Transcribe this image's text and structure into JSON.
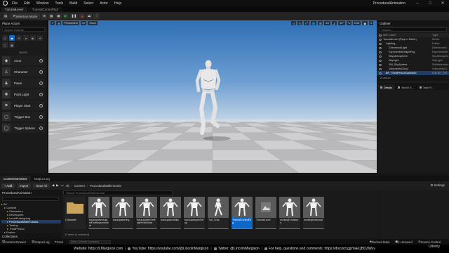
{
  "menu": {
    "items": [
      "File",
      "Edit",
      "Window",
      "Tools",
      "Build",
      "Select",
      "Actor",
      "Help"
    ],
    "project": "ProceduralAnimation"
  },
  "tabs": [
    "TutorialLevel",
    "TutorialControlRig*"
  ],
  "toolbar": {
    "mode": "Selection Mode"
  },
  "place_actors": {
    "title": "Place Actors",
    "search_placeholder": "Search Classes",
    "category_label": "BASIC",
    "actors": [
      "Actor",
      "Character",
      "Pawn",
      "Point Light",
      "Player Start",
      "Trigger Box",
      "Trigger Sphere"
    ]
  },
  "viewport": {
    "buttons_left": [
      "≡",
      "⊕",
      "Perspective",
      "Lit",
      "Show"
    ],
    "buttons_right": [
      "◇",
      "↻",
      "⤢",
      "🌐",
      "⊞",
      "10",
      "∠",
      "10°",
      "⤡",
      "0.25",
      "▣",
      "4"
    ]
  },
  "outliner": {
    "title": "Outliner",
    "search_placeholder": "Search...",
    "col_label": "Item Label",
    "col_type": "Type",
    "rows": [
      {
        "name": "TutorialLevel (Play In Editor)",
        "type": "World",
        "indent": 0,
        "sel": false
      },
      {
        "name": "Lighting",
        "type": "Folder",
        "indent": 1,
        "sel": false
      },
      {
        "name": "DirectionalLight",
        "type": "DirectionalLi",
        "indent": 2,
        "sel": false
      },
      {
        "name": "ExponentialHeightFog",
        "type": "ExponentialH",
        "indent": 2,
        "sel": false
      },
      {
        "name": "SkyAtmosphere",
        "type": "SkyAtmosphe",
        "indent": 2,
        "sel": false
      },
      {
        "name": "SkyLight",
        "type": "SkyLight",
        "indent": 2,
        "sel": false
      },
      {
        "name": "SM_SkySphere",
        "type": "StaticMeshAc",
        "indent": 2,
        "sel": false
      },
      {
        "name": "VolumetricCloud",
        "type": "VolumetricCl",
        "indent": 2,
        "sel": false
      },
      {
        "name": "BP_ThirdPersonGameMo",
        "type": "Edit BP_Thir",
        "indent": 1,
        "sel": true
      }
    ],
    "count": "13 actors"
  },
  "details": {
    "tabs": [
      "Details",
      "World S...",
      "Take R..."
    ]
  },
  "content_browser": {
    "tabs": [
      "Content Browser",
      "Output Log"
    ],
    "add_label": "+ Add",
    "import_label": "Import",
    "save_all_label": "Save All",
    "crumbs": [
      "All",
      "Content",
      "ProceduralWalkTutorial"
    ],
    "settings_label": "Settings",
    "source_title": "ProceduralAnimation",
    "tree": [
      {
        "label": "All",
        "indent": 0,
        "sel": false
      },
      {
        "label": "Content",
        "indent": 1,
        "sel": false
      },
      {
        "label": "Characters",
        "indent": 2,
        "sel": false
      },
      {
        "label": "Developers",
        "indent": 2,
        "sel": false
      },
      {
        "label": "LevelPrototyping",
        "indent": 2,
        "sel": false
      },
      {
        "label": "ProceduralWalkTutorial",
        "indent": 2,
        "sel": true
      },
      {
        "label": "Testing",
        "indent": 2,
        "sel": false
      },
      {
        "label": "ThirdPerson",
        "indent": 2,
        "sel": false
      },
      {
        "label": "Engine",
        "indent": 1,
        "sel": false
      }
    ],
    "collections_label": "Collections",
    "asset_search_placeholder": "Search ProceduralWalkTutorial",
    "assets": [
      {
        "name": "Character",
        "kind": "folder"
      },
      {
        "name": "backupAfterAdjustFootImprovement",
        "kind": "mannequin"
      },
      {
        "name": "backupstarting",
        "kind": "mannequin"
      },
      {
        "name": "backupAfterSettingPerlinNoise",
        "kind": "mannequin"
      },
      {
        "name": "backupsinvWalk",
        "kind": "mannequin"
      },
      {
        "name": "backupsimpleSetup",
        "kind": "mannequin"
      },
      {
        "name": "Tutl_Char",
        "kind": "mannequin-walk"
      },
      {
        "name": "TutorialControlRig",
        "kind": "mannequin",
        "selected": true
      },
      {
        "name": "TutorialLevel",
        "kind": "level"
      },
      {
        "name": "workingFootsteps",
        "kind": "mannequin"
      },
      {
        "name": "workingIndexinal",
        "kind": "mannequin"
      }
    ],
    "item_count": "11 items (1 selected)"
  },
  "status_bar": {
    "content_drawer": "Content Drawer",
    "output_log": "Output Log",
    "cmd": "Cmd",
    "console_placeholder": "Enter Console Command",
    "derived_data": "Derived Data",
    "unsaved": "1 Unsaved",
    "source_control": "Source Control"
  },
  "banner": {
    "website": "Website: https://LMargison.com",
    "youtube": "YouTube: https://youtube.com/@LincolnMargison",
    "twitter": "Twitter: @LincolnMargison",
    "help": "For help, questions and comments: https://discord.gg/YaEQBDZWuv"
  },
  "watermark": "Udemy",
  "colors": {
    "accent_blue": "#0f68c8",
    "play_green": "#3ec34a",
    "stop_red": "#d33333"
  }
}
